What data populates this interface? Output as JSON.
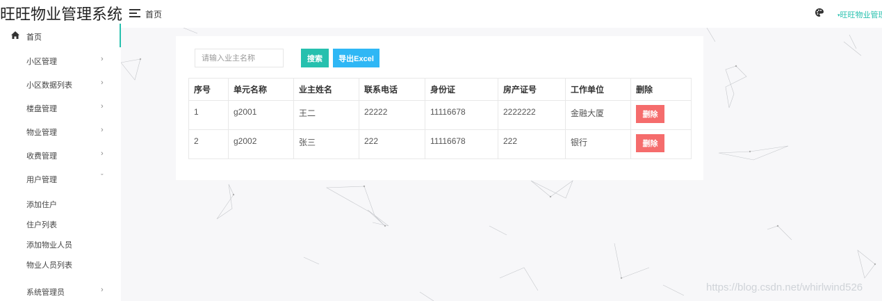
{
  "app": {
    "title": "旺旺物业管理系统"
  },
  "header": {
    "breadcrumb": "首页",
    "user_label": "旺旺物业管理"
  },
  "sidebar": {
    "home": "首页",
    "items": [
      {
        "label": "小区管理",
        "arrow": "›"
      },
      {
        "label": "小区数据列表",
        "arrow": "›"
      },
      {
        "label": "楼盘管理",
        "arrow": "›"
      },
      {
        "label": "物业管理",
        "arrow": "›"
      },
      {
        "label": "收费管理",
        "arrow": "›"
      },
      {
        "label": "用户管理",
        "arrow": "ˇ"
      }
    ],
    "sub_items": [
      "添加住户",
      "住户列表",
      "添加物业人员",
      "物业人员列表"
    ],
    "last_item": {
      "label": "系统管理员",
      "arrow": "›"
    }
  },
  "toolbar": {
    "search_placeholder": "请输入业主名称",
    "search_label": "搜索",
    "export_label": "导出Excel"
  },
  "table": {
    "columns": [
      "序号",
      "单元名称",
      "业主姓名",
      "联系电话",
      "身份证",
      "房产证号",
      "工作单位",
      "删除"
    ],
    "rows": [
      [
        "1",
        "g2001",
        "王二",
        "22222",
        "11116678",
        "2222222",
        "金融大厦"
      ],
      [
        "2",
        "g2002",
        "张三",
        "222",
        "11116678",
        "222",
        "银行"
      ]
    ],
    "delete_label": "删除"
  },
  "watermark": "https://blog.csdn.net/whirlwind526",
  "colors": {
    "accent": "#26c0ae",
    "export": "#2fb7f5",
    "danger": "#f56c6c"
  },
  "icons": [
    "menu-icon",
    "palette-icon",
    "home-icon",
    "chevron-right-icon",
    "chevron-down-icon"
  ]
}
